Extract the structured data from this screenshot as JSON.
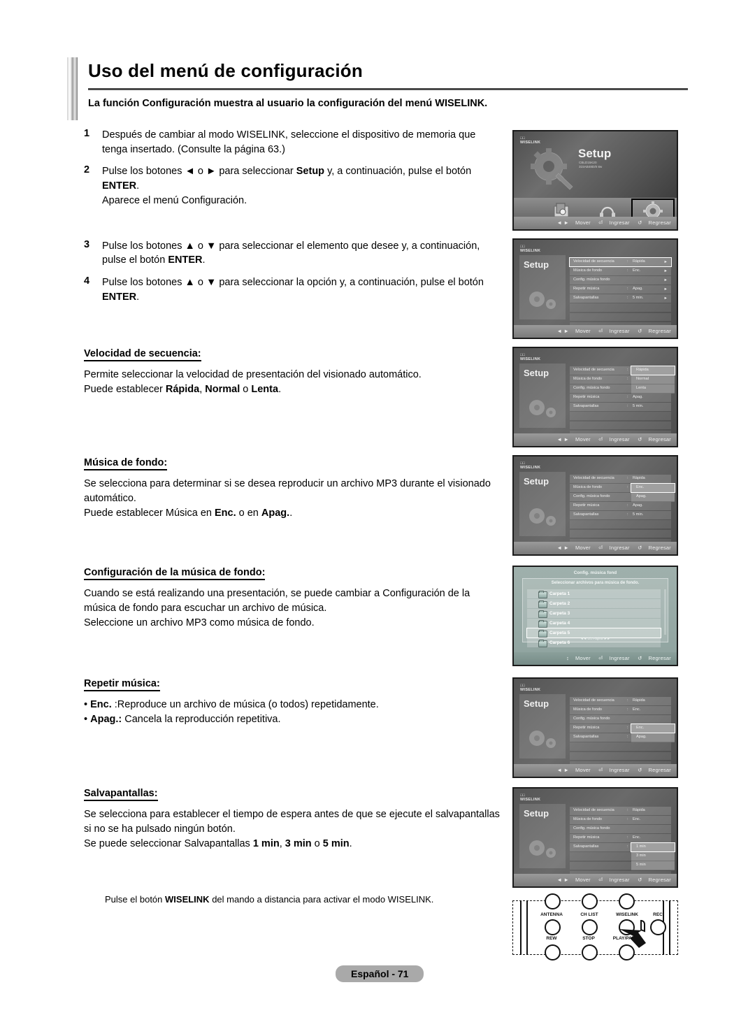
{
  "document": {
    "title": "Uso del menú de configuración",
    "subheading": "La función Configuración muestra al usuario la configuración del menú WISELINK.",
    "footer_badge": "Español - 71",
    "note": "Pulse el botón WISELINK del mando a distancia para activar el modo WISELINK."
  },
  "steps": [
    {
      "num": "1",
      "text": "Después de cambiar al modo WISELINK, seleccione el dispositivo de memoria que tenga insertado. (Consulte la página 63.)",
      "extra": ""
    },
    {
      "num": "2",
      "text_before": "Pulse los botones ◄ o ► para seleccionar ",
      "bold1": "Setup",
      "text_mid": " y, a continuación, pulse el botón ",
      "bold2": "ENTER",
      "text_after": ".",
      "extra": "Aparece el menú Configuración."
    },
    {
      "num": "3",
      "text_before": "Pulse los botones ▲ o ▼ para seleccionar el elemento que desee y, a continuación, pulse el botón ",
      "bold1": "ENTER",
      "text_after": ".",
      "extra": ""
    },
    {
      "num": "4",
      "text_before": "Pulse los botones ▲ o ▼ para seleccionar la opción y, a continuación, pulse el botón ",
      "bold1": "ENTER",
      "text_after": ".",
      "extra": ""
    }
  ],
  "sections": [
    {
      "title": "Velocidad de secuencia:",
      "line1": "Permite seleccionar la velocidad de presentación del visionado automático.",
      "line2_pre": "Puede establecer ",
      "line2_b1": "Rápida",
      "line2_m1": ", ",
      "line2_b2": "Normal",
      "line2_m2": " o ",
      "line2_b3": "Lenta",
      "line2_post": ".",
      "line3": ""
    },
    {
      "title": "Música de fondo:",
      "line1": "Se selecciona para determinar si se desea reproducir un archivo MP3 durante el visionado automático.",
      "line2_pre": "Puede establecer Música en ",
      "line2_b1": "Enc.",
      "line2_m1": " o en ",
      "line2_b2": "Apag.",
      "line2_post": ".",
      "line3": ""
    },
    {
      "title": "Configuración de la música de fondo:",
      "line1": "Cuando se está realizando una presentación, se puede cambiar a Configuración de la música de fondo para escuchar un archivo de música.",
      "line2_pre": "Seleccione un archivo MP3 como música de fondo.",
      "line3": ""
    },
    {
      "title": "Repetir música:",
      "bullet1_b": "Enc.",
      "bullet1_t": " :Reproduce un archivo de música (o todos) repetidamente.",
      "bullet2_b": "Apag.:",
      "bullet2_t": " Cancela la reproducción repetitiva."
    },
    {
      "title": "Salvapantallas:",
      "line1": "Se selecciona para establecer el tiempo de espera antes de que se ejecute el salvapantallas si no se ha pulsado ningún botón.",
      "line2_pre": "Se puede seleccionar Salvapantallas ",
      "line2_b1": "1 min",
      "line2_m1": ", ",
      "line2_b2": "3 min",
      "line2_m2": " o ",
      "line2_b3": "5 min",
      "line2_post": "."
    }
  ],
  "tv": {
    "logo": "WISELINK",
    "nav": {
      "move": "Mover",
      "enter": "Ingresar",
      "return": "Regresar"
    },
    "home": {
      "title": "Setup",
      "subtitle": "CBLD15K20\n315AB48D/8 8w",
      "icons": [
        {
          "label": "Photo",
          "name": "photo-icon"
        },
        {
          "label": "Music",
          "name": "music-icon"
        },
        {
          "label": "Setup",
          "name": "setup-gear-icon"
        }
      ],
      "selected": "Setup"
    },
    "menu_label": "Setup",
    "menu_rows": [
      {
        "label": "Velocidad de secuencia",
        "value": "Rápida"
      },
      {
        "label": "Música de fondo",
        "value": "Enc."
      },
      {
        "label": "Config. música fondo",
        "value": ""
      },
      {
        "label": "Repetir música",
        "value": "Apag."
      },
      {
        "label": "Salvapantallas",
        "value": "5 min."
      }
    ],
    "shot2_highlight": 0,
    "dropdowns": {
      "speed": {
        "row": 0,
        "options": [
          "Rápida",
          "Normal",
          "Lenta"
        ],
        "selected": 0
      },
      "bgmusic": {
        "row": 1,
        "options": [
          "Enc.",
          "Apag."
        ],
        "selected": 0
      },
      "repeat": {
        "row": 3,
        "options": [
          "Enc.",
          "Apag."
        ],
        "selected": 0
      },
      "screensaver": {
        "row": 4,
        "options": [
          "1 min",
          "3 min",
          "5 min"
        ],
        "selected": 0
      }
    },
    "shot5_rows": [
      {
        "label": "Velocidad de secuencia",
        "value": "Rápida"
      },
      {
        "label": "Música de fondo",
        "value": "Enc."
      },
      {
        "label": "Config. música fondo",
        "value": ""
      },
      {
        "label": "Repetir música",
        "value": "Apag."
      },
      {
        "label": "Salvapantallas",
        "value": "5 min."
      }
    ],
    "shot7_rows": [
      {
        "label": "Velocidad de secuencia",
        "value": "Rápida"
      },
      {
        "label": "Música de fondo",
        "value": "Enc."
      },
      {
        "label": "Config. música fondo",
        "value": ""
      },
      {
        "label": "Repetir música",
        "value": "Enc."
      },
      {
        "label": "Salvapantallas",
        "value": ""
      }
    ],
    "folder_dialog": {
      "title": "Config. música fond",
      "subtitle": "Seleccionar archivos para música de fondo.",
      "folders": [
        "Carpeta 1",
        "Carpeta 2",
        "Carpeta 3",
        "Carpeta 4",
        "Carpeta 5",
        "Carpeta 6"
      ],
      "selected": 4,
      "pager": "◄◄ 1/1 Página ►►",
      "nav": {
        "move": "Mover",
        "enter": "Ingresar",
        "return": "Regresar"
      }
    }
  },
  "remote": {
    "top_row": [
      "ANTENNA",
      "CH LIST",
      "WISELINK",
      "REC"
    ],
    "bottom_row": [
      "REW",
      "STOP",
      "PLAY/PAUSE"
    ]
  }
}
